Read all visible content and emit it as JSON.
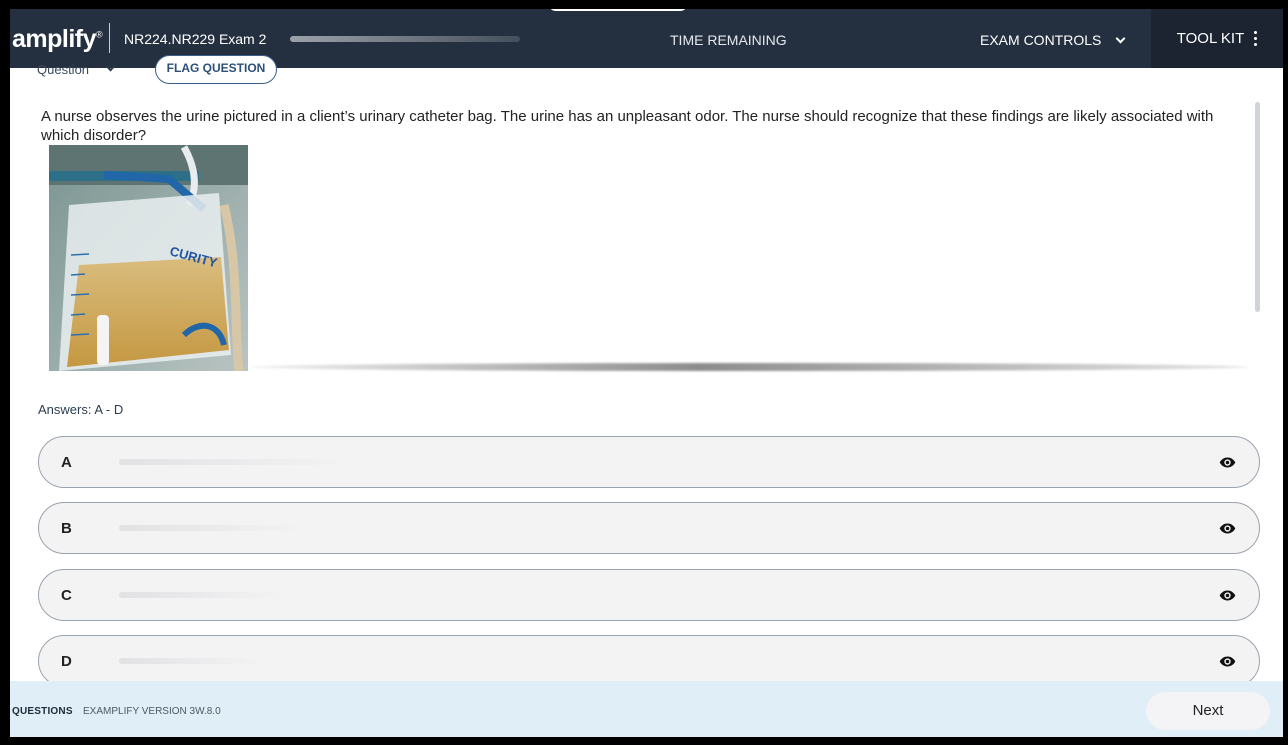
{
  "header": {
    "logo": "amplify",
    "logo_mark": "®",
    "exam_title": "NR224.NR229 Exam 2",
    "time_remaining_label": "TIME REMAINING",
    "exam_controls_label": "EXAM CONTROLS",
    "tool_kit_label": "TOOL KIT"
  },
  "toolbar": {
    "question_selector_label": "Question",
    "flag_question_label": "FLAG QUESTION"
  },
  "question": {
    "text": "A nurse observes the urine pictured in a client’s urinary catheter bag. The urine has an unpleasant odor. The nurse should recognize that these findings are likely associated with which disorder?",
    "image_brand_text": "CURITY"
  },
  "answers": {
    "label": "Answers: A - D",
    "options": [
      {
        "letter": "A"
      },
      {
        "letter": "B"
      },
      {
        "letter": "C"
      },
      {
        "letter": "D"
      }
    ]
  },
  "footer": {
    "questions_label": "QUESTIONS",
    "version_label": "EXAMPLIFY VERSION 3W.8.0",
    "next_label": "Next"
  },
  "colors": {
    "header_bg": "#243040",
    "toolkit_bg": "#1b2430",
    "footer_bg": "#dfeef7",
    "option_bg": "#f3f3f4"
  },
  "icons": {
    "options": "eye-icon",
    "toolkit": "kebab-menu-icon",
    "dropdown": "chevron-down-icon"
  }
}
